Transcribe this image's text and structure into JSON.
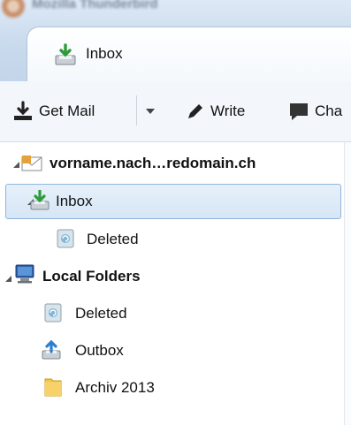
{
  "window": {
    "title": "Mozilla Thunderbird"
  },
  "tab": {
    "label": "Inbox"
  },
  "toolbar": {
    "get_mail_label": "Get Mail",
    "write_label": "Write",
    "chat_label": "Cha"
  },
  "folders": {
    "account": "vorname.nach…redomain.ch",
    "inbox": "Inbox",
    "account_deleted": "Deleted",
    "local_folders": "Local Folders",
    "local_deleted": "Deleted",
    "outbox": "Outbox",
    "archive": "Archiv 2013"
  },
  "colors": {
    "titlebar": "#c8d9ec",
    "selection_bg": "#dae8f6",
    "selection_border": "#8fb4dc",
    "inbox_green": "#2e9c3a",
    "folder_yellow": "#f4c542"
  }
}
